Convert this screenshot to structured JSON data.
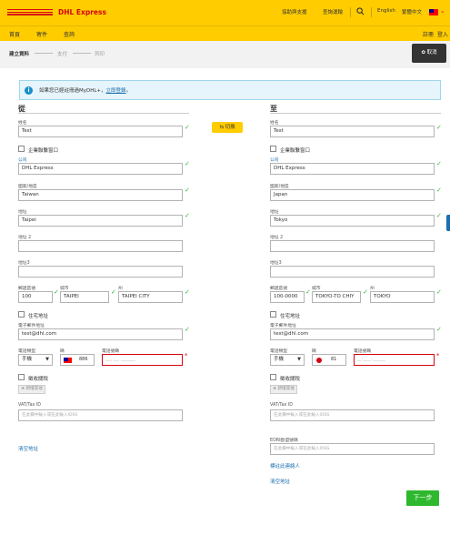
{
  "header": {
    "brand": "DHL Express",
    "links": [
      "協助與支援",
      "查詢運輸"
    ],
    "language": "English",
    "region_language": "繁體中文",
    "icons": {
      "search": "search-icon",
      "flag": "taiwan-flag-icon",
      "chevron": "chevron-down-icon"
    }
  },
  "nav": {
    "items": [
      "首頁",
      "寄件",
      "查詢"
    ],
    "right_items": [
      "註冊",
      "登入"
    ]
  },
  "steps": {
    "items": [
      "建立資料",
      "支付",
      "列印"
    ],
    "cancel_label": "取消"
  },
  "info": {
    "text": "如果您已經註冊過MyDHL+，",
    "link": "立即登錄",
    "suffix": "。"
  },
  "swap_label": "切換",
  "from": {
    "heading": "從",
    "name_label": "姓名",
    "name": "Test",
    "business_label": "企業聯繫窗口",
    "company_label": "公司",
    "company": "DHL Express",
    "country_label": "國家/地區",
    "country": "Taiwan",
    "address_label": "地址",
    "address": "Taipei",
    "address2_label": "地址 2",
    "address3_label": "地址3",
    "postal_label": "郵遞區號",
    "postal": "100",
    "city_label": "城市",
    "city": "TAIPEI",
    "state_label": "州",
    "state": "TAIPEI CITY",
    "residential_label": "住宅地址",
    "email_label": "電子郵件地址",
    "email": "test@dhl.com",
    "phone_type_label": "電話類型",
    "phone_type": "手機",
    "country_code_label": "碼",
    "country_code": "886",
    "phone_label": "電話號碼",
    "phone_placeholder": "___ ___ _______",
    "tax_label": "徵收關稅",
    "add_button": "新增其他",
    "vat_label": "VAT/Tax ID",
    "vat_placeholder": "在此欄中輸入或在此輸入IOSS",
    "clear_link": "清空地址"
  },
  "to": {
    "heading": "至",
    "name_label": "姓名",
    "name": "Test",
    "business_label": "企業聯繫窗口",
    "company_label": "公司",
    "company": "DHL Express",
    "country_label": "國家/地區",
    "country": "Japan",
    "address_label": "地址",
    "address": "Tokyo",
    "address2_label": "地址 2",
    "address3_label": "地址3",
    "postal_label": "郵遞區號",
    "postal": "100-0000",
    "city_label": "城市",
    "city": "TOKYO-TO CHIY",
    "state_label": "州",
    "state": "TOKYO",
    "residential_label": "住宅地址",
    "email_label": "電子郵件地址",
    "email": "test@dhl.com",
    "phone_type_label": "電話類型",
    "phone_type": "手機",
    "country_code_label": "碼",
    "country_code": "81",
    "phone_label": "電話號碼",
    "phone_placeholder": "__-____-______",
    "tax_label": "徵收關稅",
    "add_button": "新增其他",
    "vat_label": "VAT/Tax ID",
    "vat_placeholder": "在此欄中輸入或在此輸入IOSS",
    "eori_label": "EORI歐盟號碼",
    "eori_placeholder": "在此欄中輸入或在此輸入IOSS",
    "more_link": "標註此連絡人",
    "clear_link": "清空地址"
  },
  "next_label": "下一步",
  "colors": {
    "brand_yellow": "#ffcc00",
    "brand_red": "#d40511",
    "success_green": "#2eb82e",
    "link_blue": "#1a6fb0"
  }
}
